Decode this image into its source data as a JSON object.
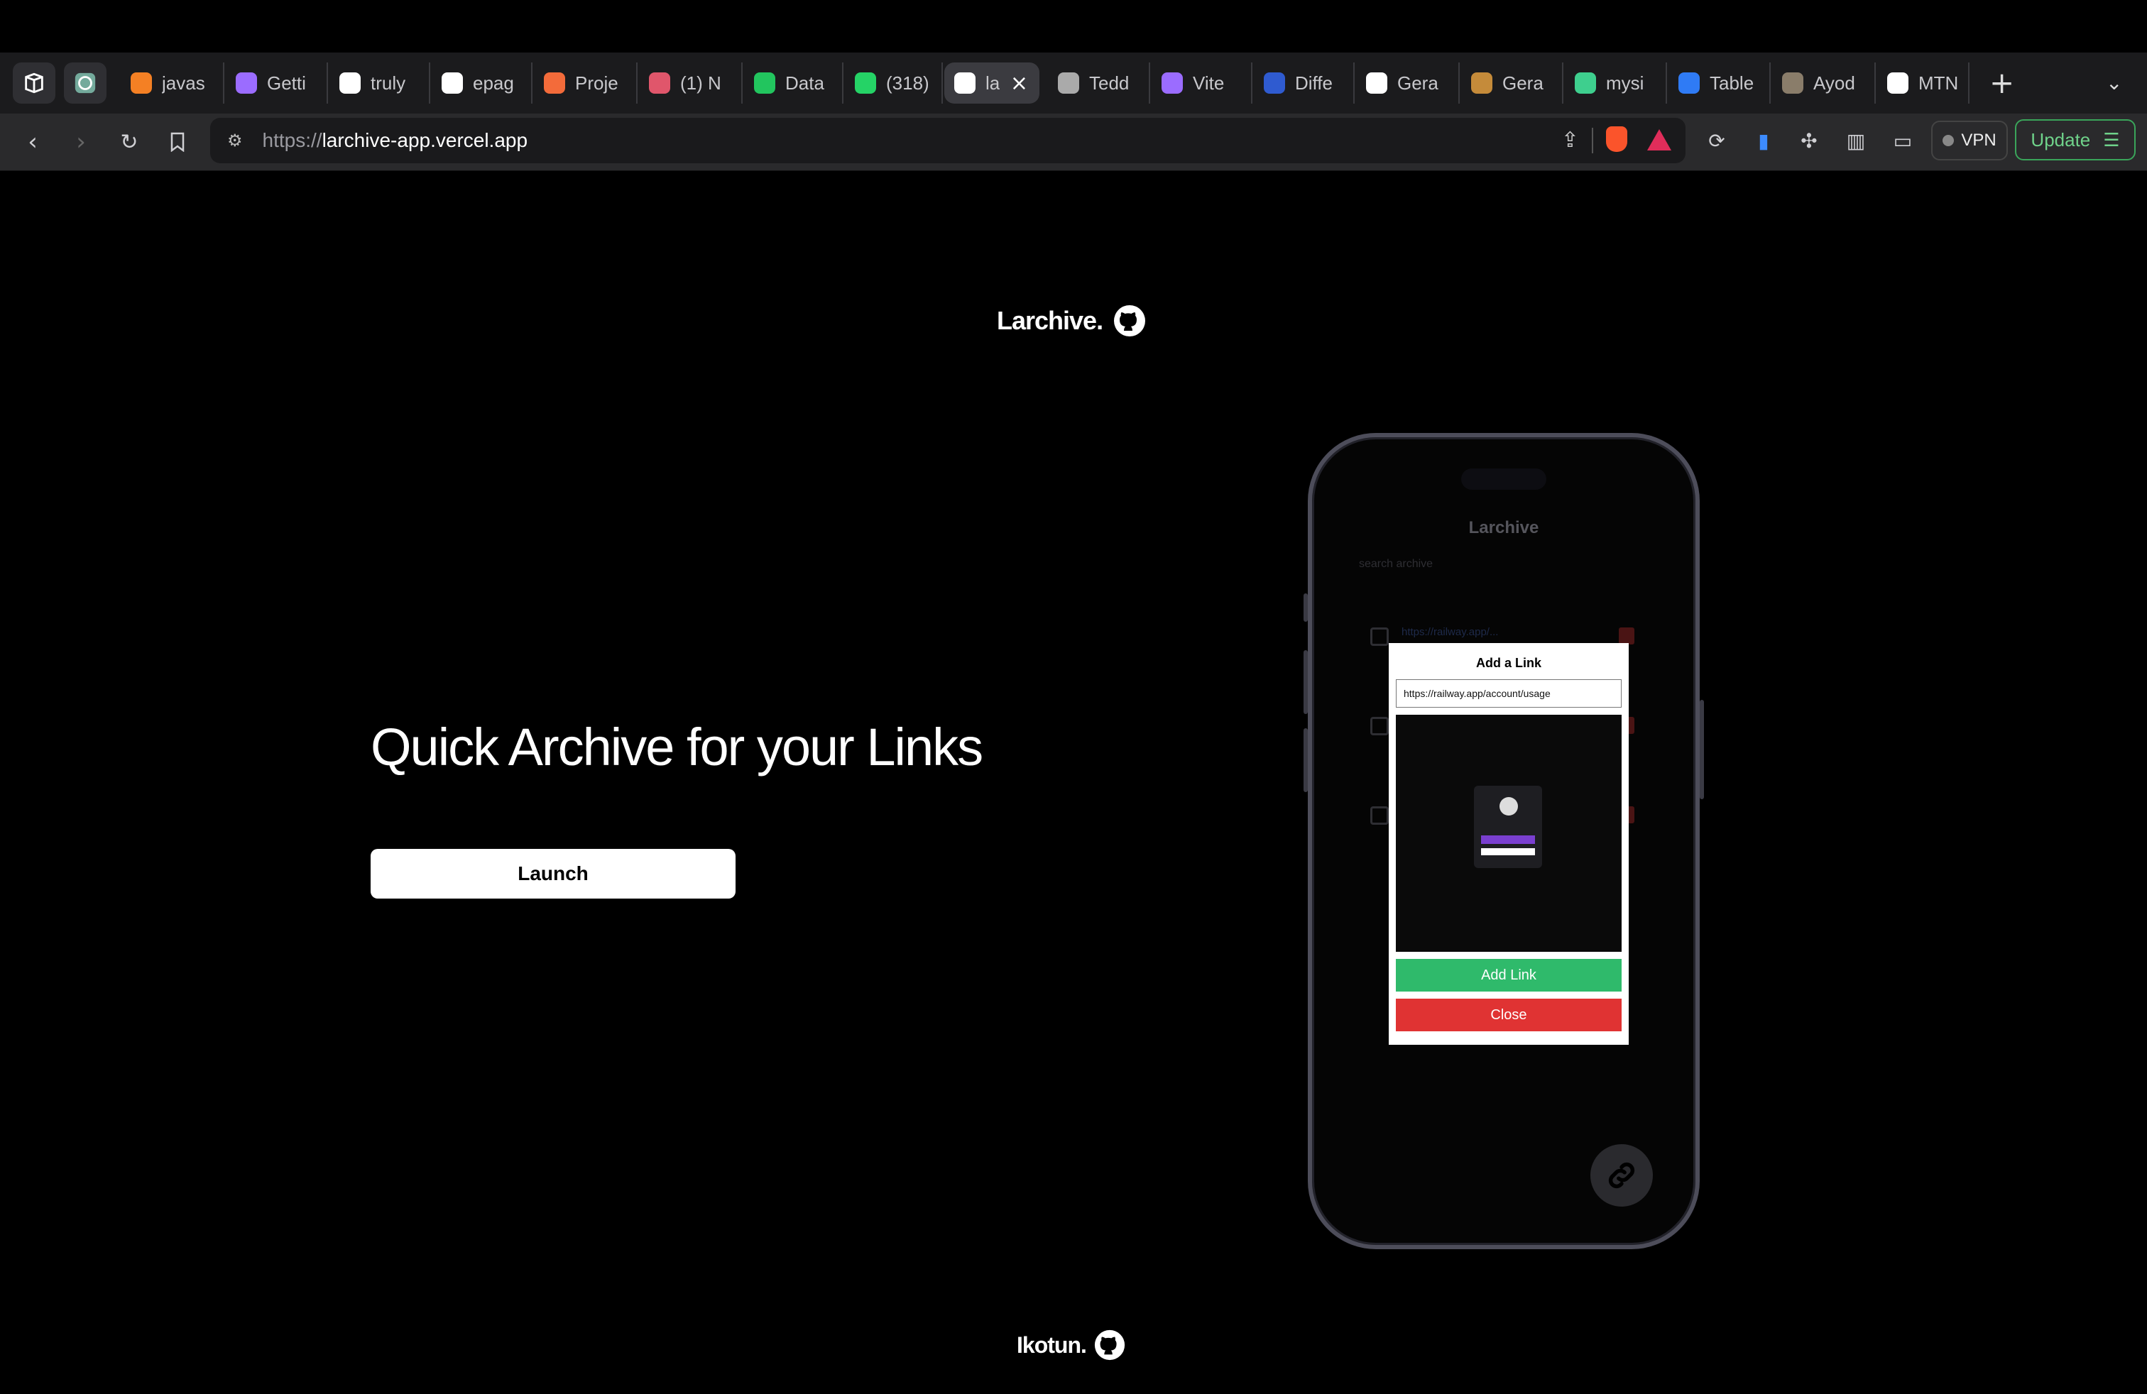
{
  "browser": {
    "tabs": [
      {
        "label": "javas",
        "icon": "stackoverflow-icon",
        "color": "#f48024"
      },
      {
        "label": "Getti",
        "icon": "vite-icon",
        "color": "#9b6cff"
      },
      {
        "label": "truly",
        "icon": "github-icon",
        "color": "#ffffff"
      },
      {
        "label": "epag",
        "icon": "github-icon",
        "color": "#ffffff"
      },
      {
        "label": "Proje",
        "icon": "circle-icon",
        "color": "#f36b3a"
      },
      {
        "label": "(1) N",
        "icon": "play-icon",
        "color": "#e0566b"
      },
      {
        "label": "Data",
        "icon": "leaf-icon",
        "color": "#22c55e"
      },
      {
        "label": "(318)",
        "icon": "whatsapp-icon",
        "color": "#25d366"
      },
      {
        "label": "la",
        "icon": "larchive-icon",
        "color": "#ffffff"
      },
      {
        "label": "Tedd",
        "icon": "tb-icon",
        "color": "#aaaaaa"
      },
      {
        "label": "Vite",
        "icon": "vite-icon",
        "color": "#9b6cff"
      },
      {
        "label": "Diffe",
        "icon": "b-icon",
        "color": "#2f5bd0"
      },
      {
        "label": "Gera",
        "icon": "g-icon",
        "color": "#ffffff"
      },
      {
        "label": "Gera",
        "icon": "g-icon",
        "color": "#c58b3a"
      },
      {
        "label": "mysi",
        "icon": "v-icon",
        "color": "#3ecf8e"
      },
      {
        "label": "Table",
        "icon": "terminal-icon",
        "color": "#2f7bf5"
      },
      {
        "label": "Ayod",
        "icon": "photo-icon",
        "color": "#8a7d6a"
      },
      {
        "label": "MTN",
        "icon": "mtn-icon",
        "color": "#ffffff"
      }
    ],
    "url_prefix": "https://",
    "url_host": "larchive-app.vercel.app",
    "vpn_label": "VPN",
    "update_label": "Update"
  },
  "page": {
    "brand": "Larchive.",
    "headline": "Quick Archive for your Links",
    "launch_label": "Launch",
    "footer": "Ikotun."
  },
  "phone": {
    "app_title": "Larchive",
    "search_placeholder": "search archive",
    "first_link": "https://railway.app/...",
    "modal": {
      "title": "Add a Link",
      "input_value": "https://railway.app/account/usage",
      "add_label": "Add Link",
      "close_label": "Close"
    }
  }
}
